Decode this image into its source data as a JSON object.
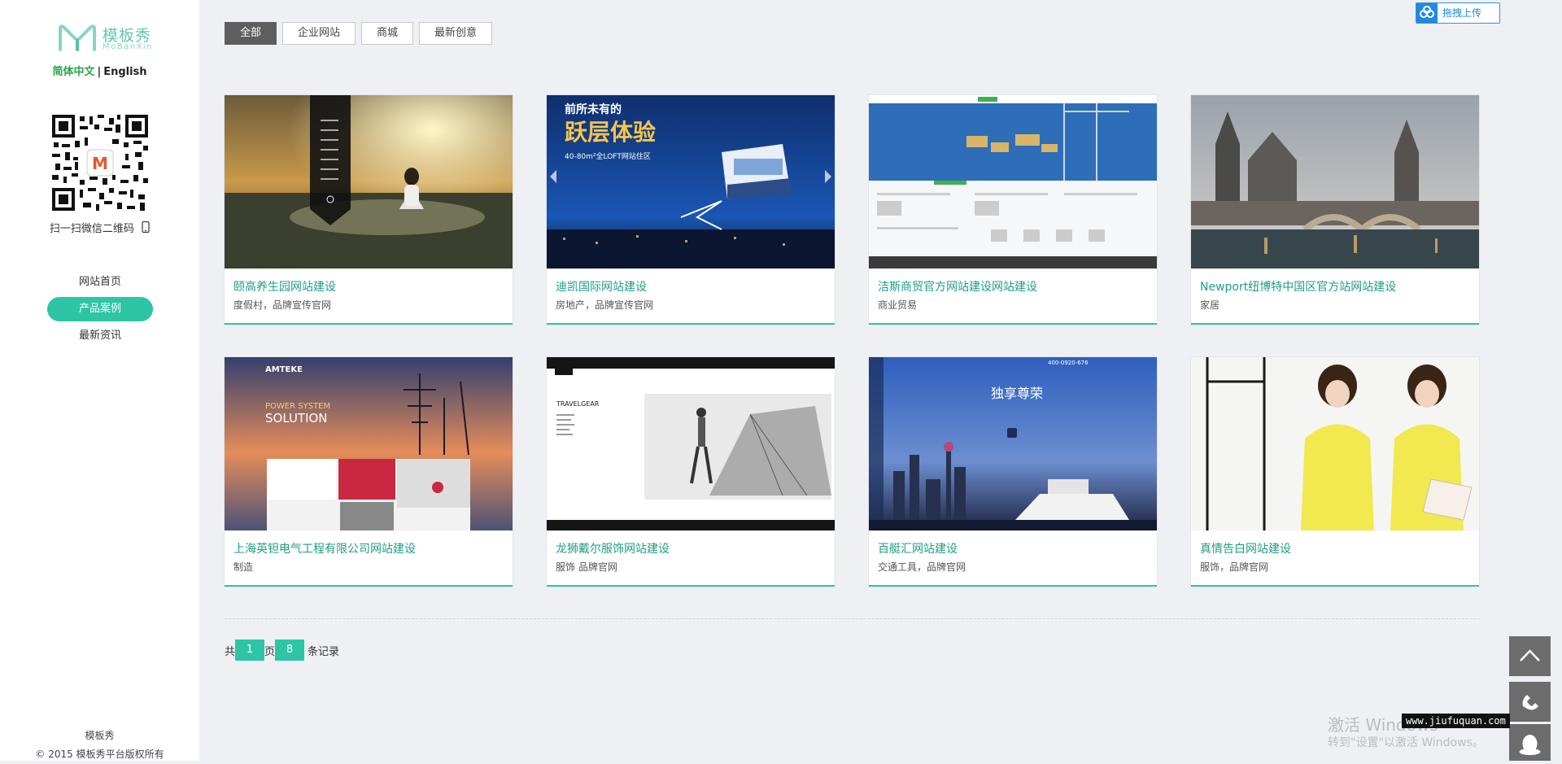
{
  "sidebar": {
    "logo": {
      "cn": "模板秀",
      "en": "MoBanXin"
    },
    "lang": {
      "cn": "简体中文",
      "sep": "|",
      "en": "English"
    },
    "qr_caption": "扫一扫微信二维码",
    "nav": [
      {
        "label": "网站首页",
        "active": false
      },
      {
        "label": "产品案例",
        "active": true
      },
      {
        "label": "最新资讯",
        "active": false
      }
    ],
    "footer": {
      "line1": "模板秀",
      "line2": "© 2015 模板秀平台版权所有"
    }
  },
  "filters": [
    {
      "label": "全部",
      "active": true
    },
    {
      "label": "企业网站",
      "active": false
    },
    {
      "label": "商城",
      "active": false
    },
    {
      "label": "最新创意",
      "active": false
    }
  ],
  "upload": {
    "label": "拖拽上传"
  },
  "cards": [
    {
      "title": "颐高养生园网站建设",
      "tags": "度假村，品牌宣传官网"
    },
    {
      "title": "迪凯国际网站建设",
      "tags": "房地产，品牌宣传官网"
    },
    {
      "title": "洁斯商贸官方网站建设网站建设",
      "tags": "商业贸易"
    },
    {
      "title": "Newport纽博特中国区官方站网站建设",
      "tags": "家居"
    },
    {
      "title": "上海英钽电气工程有限公司网站建设",
      "tags": "制造"
    },
    {
      "title": "龙狮戴尔服饰网站建设",
      "tags": "服饰 品牌官网"
    },
    {
      "title": "百艇汇网站建设",
      "tags": "交通工具，品牌官网"
    },
    {
      "title": "真情告白网站建设",
      "tags": "服饰，品牌官网"
    }
  ],
  "thumb_text": {
    "c2_heading": "前所未有的",
    "c2_big": "跃层体验",
    "c2_sub": "40-80m²全LOFT网站住区",
    "c5_logo": "AMTEKE",
    "c5_headline1": "POWER SYSTEM",
    "c5_headline2": "SOLUTION",
    "c6_label": "TRAVELGEAR",
    "c7_heading": "独享尊荣",
    "c7_phone": "400-0920-676"
  },
  "pager": {
    "prefix": "共",
    "pages": "1",
    "mid": "页",
    "records": "8",
    "suffix": "条记录"
  },
  "watermark": {
    "line1": "激活 Windows",
    "line2": "转到\"设置\"以激活 Windows。"
  },
  "site_stamp": "www.jiufuquan.com"
}
